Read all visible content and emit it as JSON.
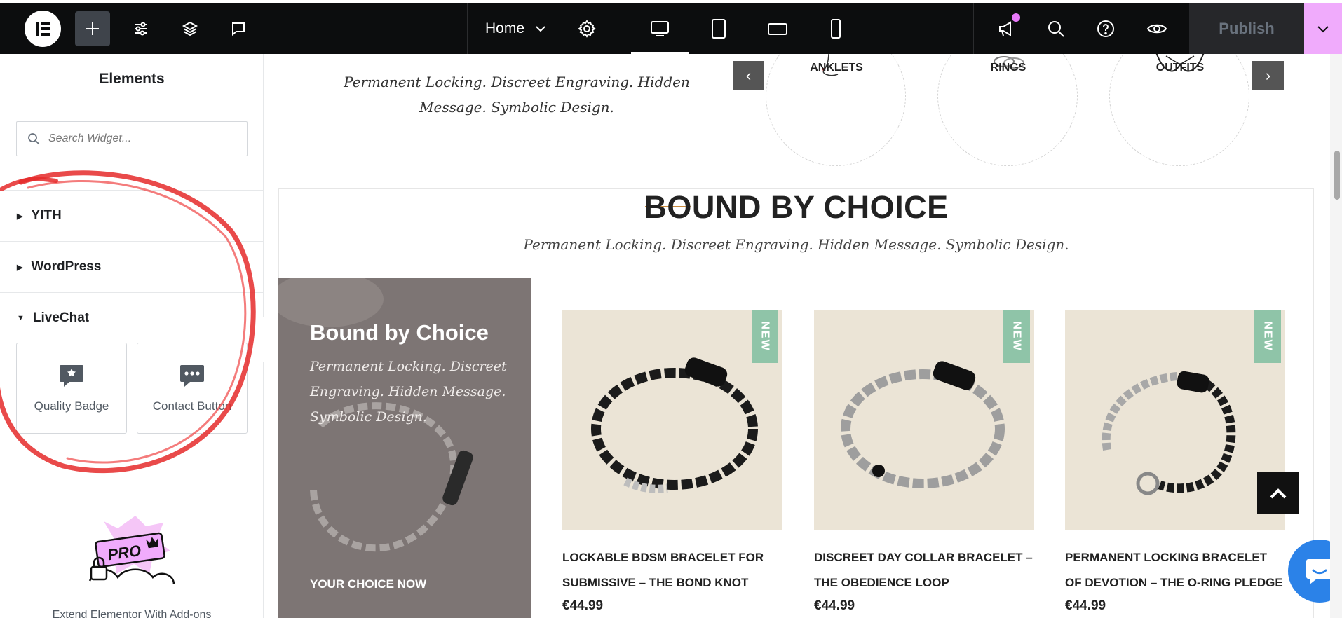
{
  "topbar": {
    "page_name": "Home",
    "publish_label": "Publish",
    "colors": {
      "bar": "#0c0d0e",
      "accent": "#f0abfc"
    }
  },
  "sidebar": {
    "title": "Elements",
    "search_placeholder": "Search Widget...",
    "categories": [
      {
        "label": "YITH",
        "expanded": false
      },
      {
        "label": "WordPress",
        "expanded": false
      },
      {
        "label": "LiveChat",
        "expanded": true
      }
    ],
    "widgets": [
      {
        "label": "Quality Badge",
        "icon": "chat-badge-icon"
      },
      {
        "label": "Contact Button",
        "icon": "chat-dots-icon"
      }
    ],
    "pro_badge": "PRO",
    "promo_text": "Extend Elementor With Add-ons"
  },
  "canvas": {
    "hero_subtitle": "Permanent Locking. Discreet Engraving. Hidden Message. Symbolic Design.",
    "categories": [
      "ANKLETS",
      "RINGS",
      "OUTFITS"
    ],
    "section_title": "BOUND BY CHOICE",
    "section_subtitle": "Permanent Locking. Discreet Engraving. Hidden Message. Symbolic Design.",
    "promo": {
      "title": "Bound by Choice",
      "text": "Permanent Locking. Discreet Engraving. Hidden Message. Symbolic Design.",
      "link": "YOUR CHOICE NOW"
    },
    "products": [
      {
        "name": "LOCKABLE BDSM BRACELET FOR SUBMISSIVE – THE BOND KNOT",
        "price": "€44.99",
        "badge": "NEW"
      },
      {
        "name": "DISCREET DAY COLLAR BRACELET – THE OBEDIENCE LOOP",
        "price": "€44.99",
        "badge": "NEW"
      },
      {
        "name": "PERMANENT LOCKING BRACELET OF DEVOTION – THE O-RING PLEDGE",
        "price": "€44.99",
        "badge": "NEW"
      }
    ]
  }
}
